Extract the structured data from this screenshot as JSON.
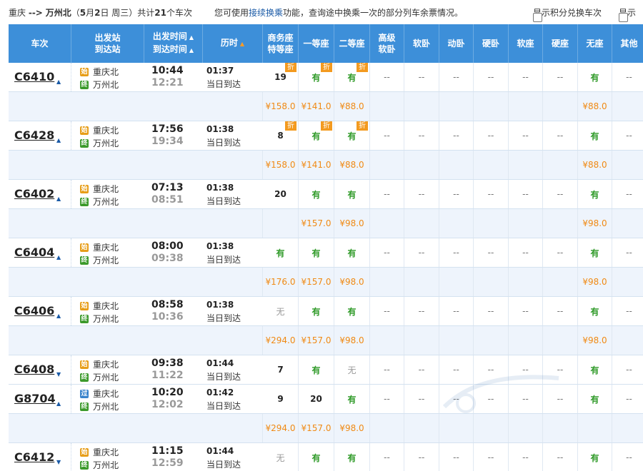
{
  "header": {
    "from": "重庆",
    "arrow": "-->",
    "to": "万州北",
    "date_open": "（",
    "date_month": "5",
    "date_mid": "月",
    "date_day": "2",
    "date_tail": "日  周三）共计",
    "count": "21",
    "count_tail": "个车次",
    "hint_pre": "您可使用",
    "hint_link": "接续换乘",
    "hint_post": "功能，查询途中换乘一次的部分列车余票情况。",
    "opt_points": "显示积分兑换车次",
    "opt_more": "显示"
  },
  "columns": {
    "train": "车次",
    "station_a": "出发站",
    "station_b": "到达站",
    "time_a": "出发时间",
    "time_b": "到达时间",
    "duration": "历时",
    "biz_a": "商务座",
    "biz_b": "特等座",
    "first": "一等座",
    "second": "二等座",
    "adv_a": "高级",
    "adv_b": "软卧",
    "soft_sleeper": "软卧",
    "dyn_sleeper": "动卧",
    "hard_sleeper": "硬卧",
    "soft_seat": "软座",
    "hard_seat": "硬座",
    "no_seat": "无座",
    "other": "其他"
  },
  "labels": {
    "from_station": "重庆北",
    "to_station": "万州北",
    "same_day": "当日到达",
    "badge_start": "始",
    "badge_pass": "过",
    "badge_end": "终",
    "discount": "折",
    "dash": "--"
  },
  "trains": [
    {
      "no": "C6410",
      "dir": "▲",
      "badge": "始",
      "dep": "10:44",
      "arr": "12:21",
      "dur": "01:37",
      "biz": "19",
      "first": "有",
      "second": "有",
      "noseat": "有",
      "discount": true,
      "price": {
        "biz": "¥158.0",
        "first": "¥141.0",
        "second": "¥88.0",
        "noseat": "¥88.0"
      }
    },
    {
      "no": "C6428",
      "dir": "▲",
      "badge": "始",
      "dep": "17:56",
      "arr": "19:34",
      "dur": "01:38",
      "biz": "8",
      "first": "有",
      "second": "有",
      "noseat": "有",
      "discount": true,
      "price": {
        "biz": "¥158.0",
        "first": "¥141.0",
        "second": "¥88.0",
        "noseat": "¥88.0"
      }
    },
    {
      "no": "C6402",
      "dir": "▲",
      "badge": "始",
      "dep": "07:13",
      "arr": "08:51",
      "dur": "01:38",
      "biz": "20",
      "first": "有",
      "second": "有",
      "noseat": "有",
      "discount": false,
      "price": {
        "biz": "",
        "first": "¥157.0",
        "second": "¥98.0",
        "noseat": "¥98.0"
      }
    },
    {
      "no": "C6404",
      "dir": "▲",
      "badge": "始",
      "dep": "08:00",
      "arr": "09:38",
      "dur": "01:38",
      "biz": "有",
      "first": "有",
      "second": "有",
      "noseat": "有",
      "discount": false,
      "price": {
        "biz": "¥176.0",
        "first": "¥157.0",
        "second": "¥98.0",
        "noseat": "¥98.0"
      }
    },
    {
      "no": "C6406",
      "dir": "▲",
      "badge": "始",
      "dep": "08:58",
      "arr": "10:36",
      "dur": "01:38",
      "biz": "无",
      "first": "有",
      "second": "有",
      "noseat": "有",
      "discount": false,
      "price": {
        "biz": "¥294.0",
        "first": "¥157.0",
        "second": "¥98.0",
        "noseat": "¥98.0"
      }
    },
    {
      "no": "C6408",
      "dir": "▼",
      "badge": "始",
      "dep": "09:38",
      "arr": "11:22",
      "dur": "01:44",
      "biz": "7",
      "first": "有",
      "second": "无",
      "noseat": "有",
      "discount": false,
      "price": null
    },
    {
      "no": "G8704",
      "dir": "▲",
      "badge": "过",
      "dep": "10:20",
      "arr": "12:02",
      "dur": "01:42",
      "biz": "9",
      "first": "20",
      "second": "有",
      "noseat": "有",
      "discount": false,
      "price": {
        "biz": "¥294.0",
        "first": "¥157.0",
        "second": "¥98.0",
        "noseat": ""
      }
    },
    {
      "no": "C6412",
      "dir": "▼",
      "badge": "始",
      "dep": "11:15",
      "arr": "12:59",
      "dur": "01:44",
      "biz": "无",
      "first": "有",
      "second": "有",
      "noseat": "有",
      "discount": false,
      "price": null
    }
  ],
  "colors": {
    "header_bg": "#3d8fd9",
    "yes": "#2f9a28",
    "price": "#f08a14",
    "discount_tag": "#f39a1f"
  }
}
